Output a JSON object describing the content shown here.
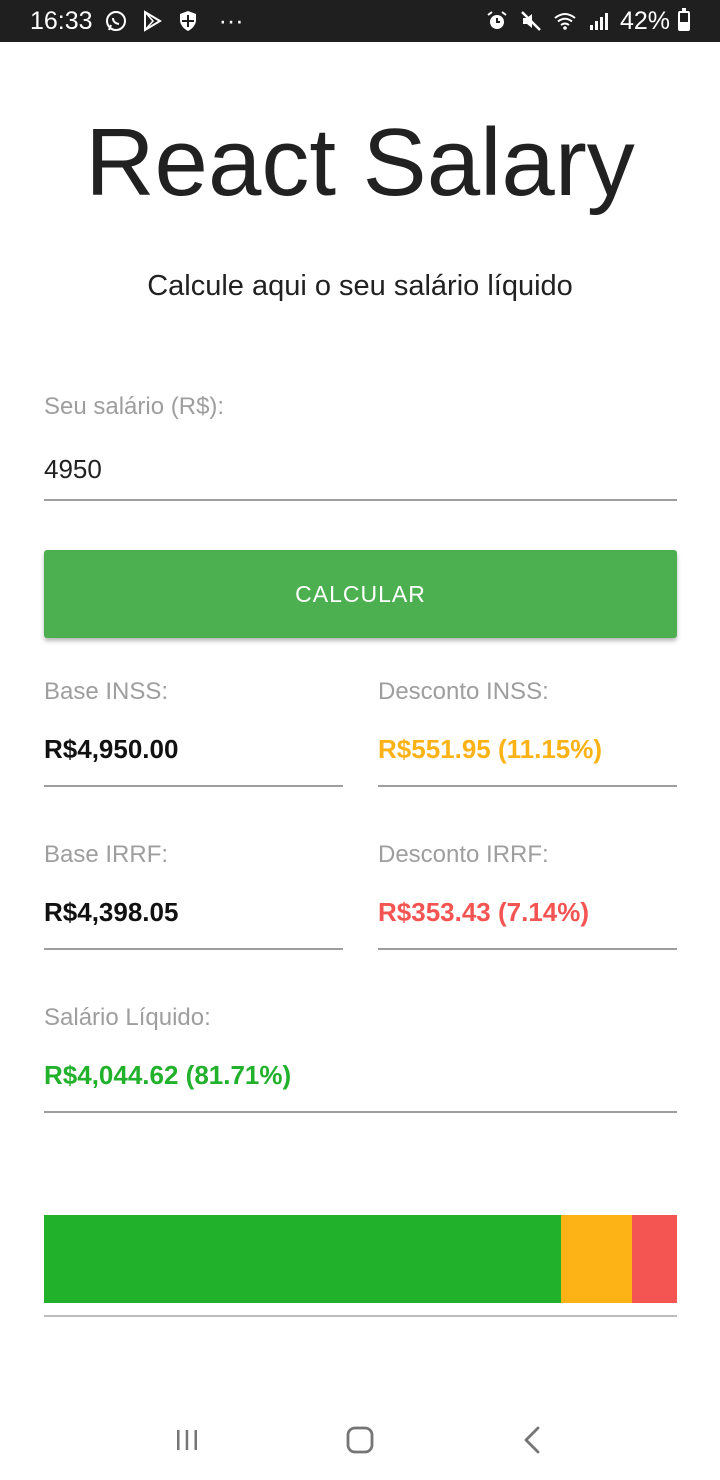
{
  "status_bar": {
    "time": "16:33",
    "overflow": "···",
    "battery_percent": "42%",
    "battery_level": 0.42,
    "left_icons": [
      "whatsapp-icon",
      "play-store-icon",
      "shield-icon"
    ],
    "right_icons": [
      "alarm-icon",
      "mute-icon",
      "wifi-icon",
      "signal-icon",
      "battery-icon"
    ]
  },
  "header": {
    "title": "React Salary",
    "subtitle": "Calcule aqui o seu salário líquido"
  },
  "form": {
    "salary_label": "Seu salário (R$):",
    "salary_value": "4950",
    "calculate_label": "CALCULAR"
  },
  "results": {
    "base_inss_label": "Base INSS:",
    "base_inss_value": "R$4,950.00",
    "desconto_inss_label": "Desconto INSS:",
    "desconto_inss_value": "R$551.95 (11.15%)",
    "base_irrf_label": "Base IRRF:",
    "base_irrf_value": "R$4,398.05",
    "desconto_irrf_label": "Desconto IRRF:",
    "desconto_irrf_value": "R$353.43 (7.14%)",
    "salario_liquido_label": "Salário Líquido:",
    "salario_liquido_value": "R$4,044.62 (81.71%)"
  },
  "bar": {
    "segments": [
      {
        "name": "salario-liquido",
        "percent": 81.71,
        "color": "#21b12b"
      },
      {
        "name": "desconto-inss",
        "percent": 11.15,
        "color": "#fdb216"
      },
      {
        "name": "desconto-irrf",
        "percent": 7.14,
        "color": "#f55552"
      }
    ]
  },
  "colors": {
    "button": "#4caf50",
    "inss": "#fdb216",
    "irrf": "#f55552",
    "liquido": "#21b12b",
    "label": "#9e9e9e"
  },
  "nav": {
    "icons": [
      "recent-apps-icon",
      "home-icon",
      "back-icon"
    ]
  }
}
